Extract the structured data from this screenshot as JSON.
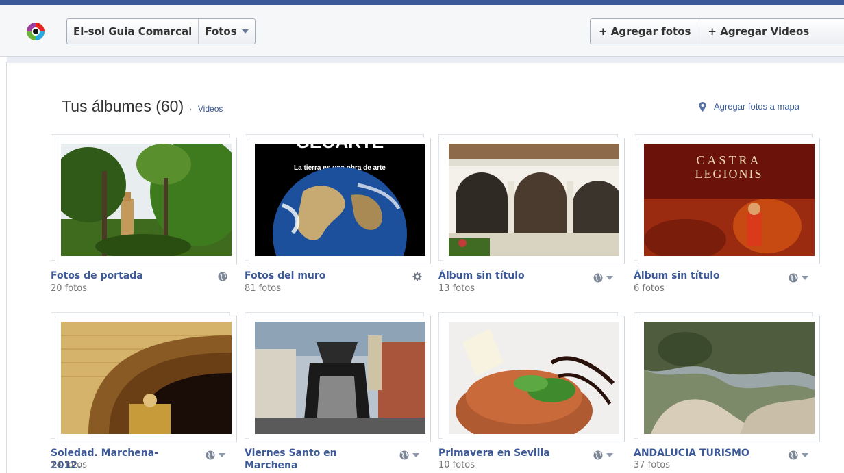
{
  "header": {
    "breadcrumb_page": "El-sol Guia Comarcal",
    "breadcrumb_section": "Fotos",
    "add_photos": "+ Agregar fotos",
    "add_videos": "+ Agregar Videos"
  },
  "main": {
    "section_title": "Tus álbumes (60)",
    "separator": "·",
    "videos_link": "Videos",
    "map_link": "Agregar fotos a mapa"
  },
  "albums": [
    {
      "title": "Fotos de portada",
      "count": "20 fotos",
      "privacy_icon": "globe-icon"
    },
    {
      "title": "Fotos del muro",
      "count": "81 fotos",
      "privacy_icon": "gear-icon"
    },
    {
      "title": "Álbum sin título",
      "count": "13 fotos",
      "privacy_icon": "globe-icon"
    },
    {
      "title": "Álbum sin título",
      "count": "6 fotos",
      "privacy_icon": "globe-icon"
    },
    {
      "title": "Soledad. Marchena-2012.",
      "count": "14 fotos",
      "privacy_icon": "globe-icon"
    },
    {
      "title": "Viernes Santo en Marchena",
      "count": "",
      "privacy_icon": "globe-icon"
    },
    {
      "title": "Primavera en Sevilla",
      "count": "10 fotos",
      "privacy_icon": "globe-icon"
    },
    {
      "title": "ANDALUCIA TURISMO",
      "count": "37 fotos",
      "privacy_icon": "globe-icon"
    }
  ],
  "cover_text": {
    "earth_top": "GEOARTE",
    "earth_tagline": "La tierra es una obra de arte",
    "castra_line1": "CASTRA",
    "castra_line2": "LEGIONIS"
  },
  "colors": {
    "brand_blue": "#3b5998",
    "link": "#3b5998",
    "header_bg": "#f6f7f9"
  }
}
